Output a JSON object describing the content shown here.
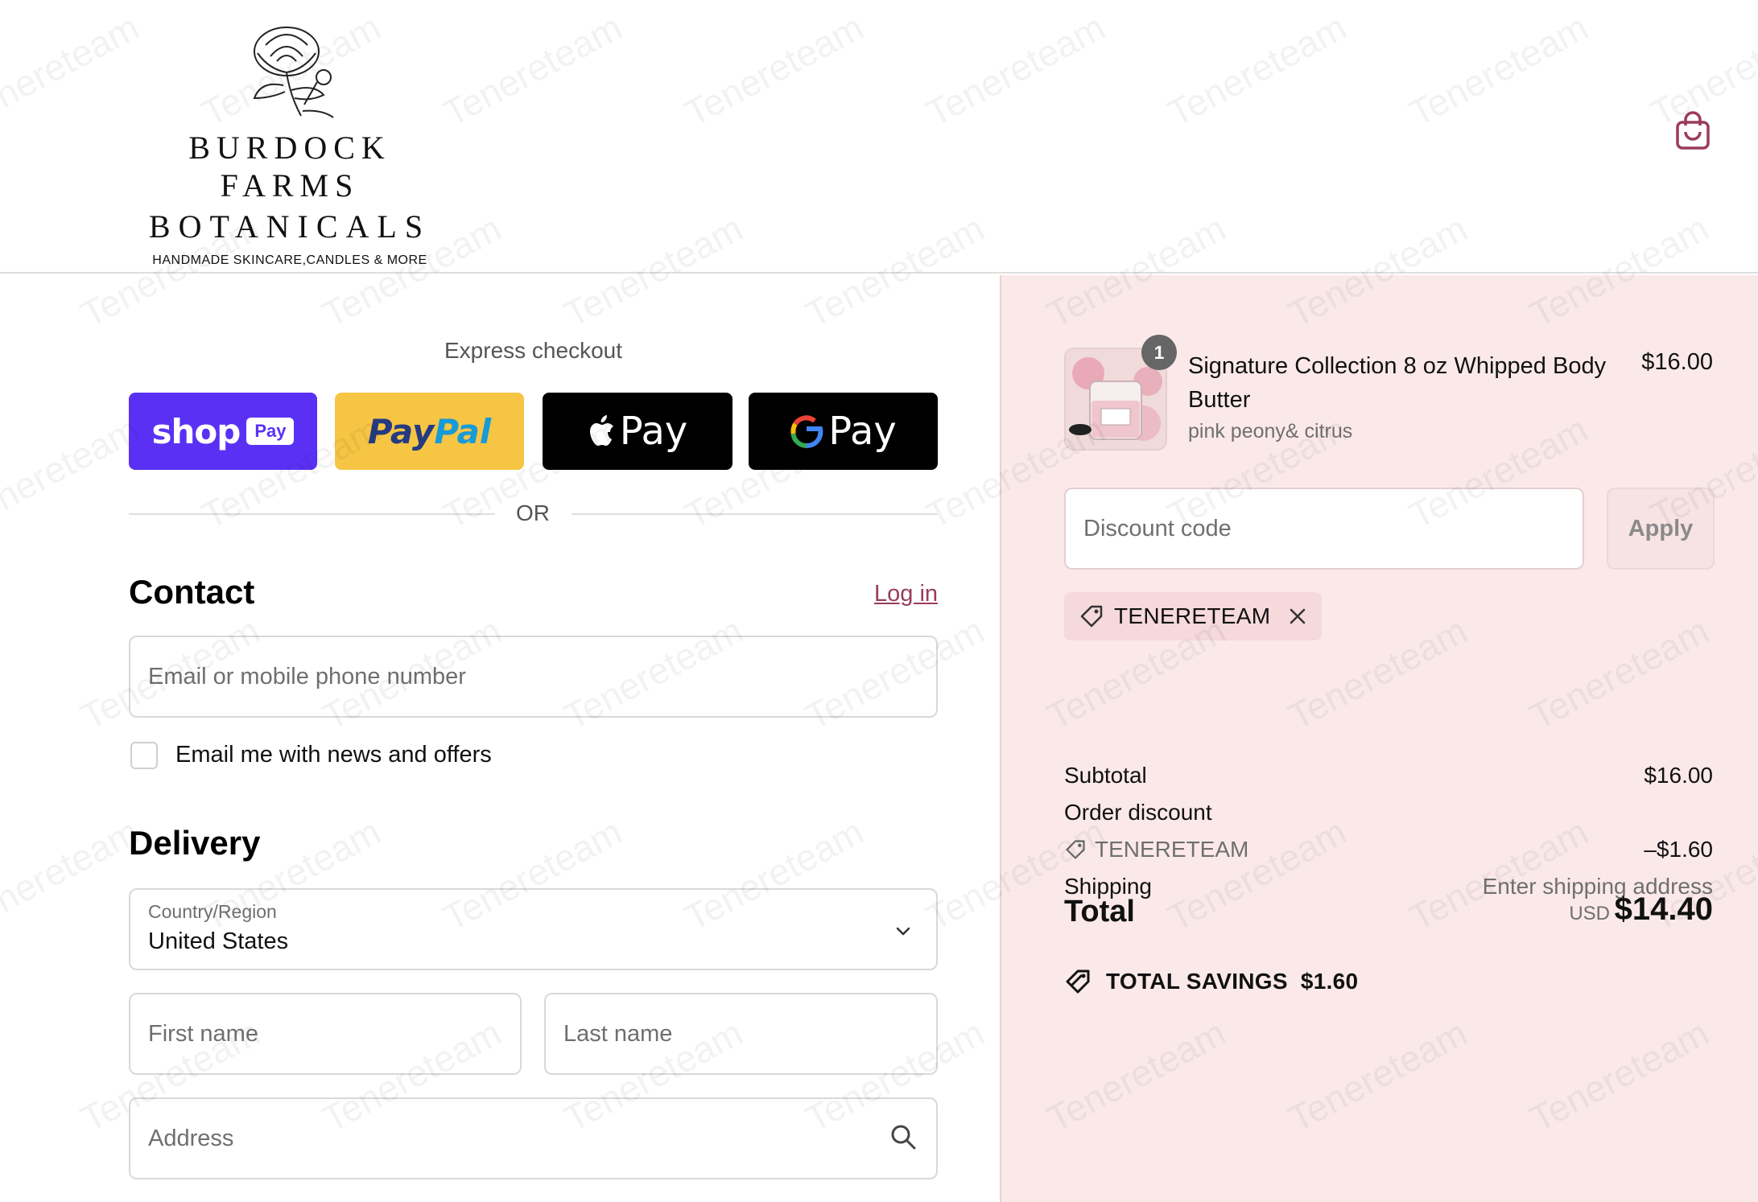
{
  "brand": {
    "name_line1": "BURDOCK FARMS",
    "name_line2": "BOTANICALS",
    "tagline": "HANDMADE SKINCARE,CANDLES & MORE"
  },
  "header": {
    "cart_icon": "shopping-bag-icon"
  },
  "express": {
    "title": "Express checkout",
    "shop_pay": {
      "word": "shop",
      "pill": "Pay"
    },
    "paypal": {
      "part1": "Pay",
      "part2": "Pal"
    },
    "apple_pay": {
      "label": "Pay"
    },
    "google_pay": {
      "label": "Pay"
    },
    "or": "OR"
  },
  "contact": {
    "title": "Contact",
    "login": "Log in",
    "email_placeholder": "Email or mobile phone number",
    "newsletter_label": "Email me with news and offers"
  },
  "delivery": {
    "title": "Delivery",
    "country_label": "Country/Region",
    "country_value": "United States",
    "first_name_placeholder": "First name",
    "last_name_placeholder": "Last name",
    "address_placeholder": "Address"
  },
  "summary": {
    "item": {
      "quantity": "1",
      "name": "Signature Collection 8 oz Whipped Body Butter",
      "variant": "pink peony& citrus",
      "price": "$16.00"
    },
    "discount_placeholder": "Discount code",
    "apply": "Apply",
    "applied_code": "TENERETEAM",
    "subtotal_label": "Subtotal",
    "subtotal_value": "$16.00",
    "order_discount_label": "Order discount",
    "order_discount_code": "TENERETEAM",
    "order_discount_value": "–$1.60",
    "shipping_label": "Shipping",
    "shipping_value": "Enter shipping address",
    "total_label": "Total",
    "currency": "USD",
    "total_value": "$14.40",
    "savings_label": "TOTAL SAVINGS",
    "savings_value": "$1.60"
  },
  "colors": {
    "shop_pay": "#5a31f4",
    "paypal": "#f7c544",
    "summary_bg": "#fbe9ea",
    "link": "#9a3b5e"
  },
  "watermark": "Tenereteam"
}
